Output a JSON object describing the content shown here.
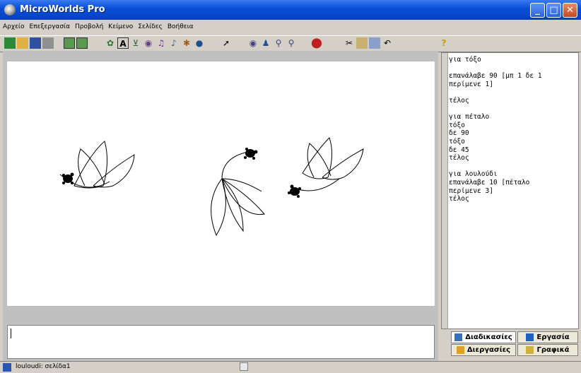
{
  "window": {
    "title": "MicroWorlds Pro",
    "minimize": "_",
    "maximize": "□",
    "close": "✕"
  },
  "menu": [
    "Αρχείο",
    "Επεξεργασία",
    "Προβολή",
    "Κείμενο",
    "Σελίδες",
    "Βοήθεια"
  ],
  "toolbar_icons": [
    "new-project",
    "open-project",
    "save-project",
    "print",
    "page-view",
    "fullscreen",
    "turtle",
    "text-box",
    "button",
    "slider",
    "music",
    "sound",
    "shapes",
    "paint",
    "pointer",
    "eye",
    "stamp",
    "zoom-in",
    "zoom-out",
    "stop",
    "cut",
    "copy",
    "paste",
    "undo",
    "help"
  ],
  "procedures": "για τόξο\n\nεπανάλαβε 90 [μπ 1 δε 1\nπερίμενε 1]\n\nτέλος\n\nγια πέταλο\nτόξο\nδε 90\nτόξο\nδε 45\nτέλος\n\nγια λουλούδι\nεπανάλαβε 10 [πέταλο\nπερίμενε 3]\nτέλος",
  "tabs": {
    "procedures": "Διαδικασίες",
    "project": "Εργασία",
    "processes": "Διεργασίες",
    "graphics": "Γραφικά"
  },
  "status": "louloudi: σελίδα1",
  "colors": {
    "title_bar": "#0a4fd8",
    "workspace": "#c0c0c0",
    "canvas": "#ffffff"
  }
}
